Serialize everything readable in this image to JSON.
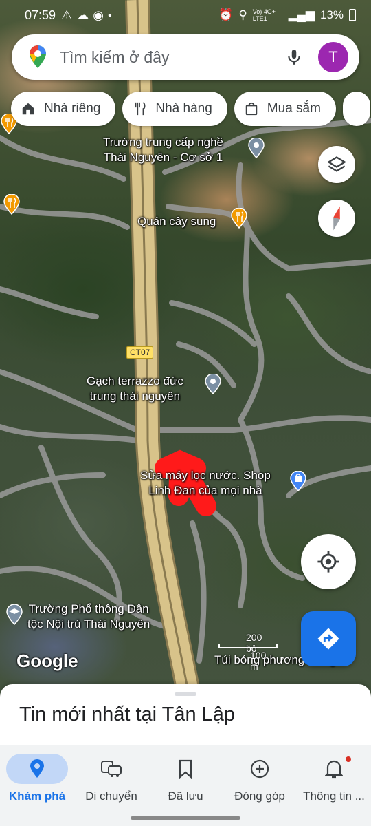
{
  "status_bar": {
    "time": "07:59",
    "network": "Vo) 4G+ LTE1",
    "battery": "13%"
  },
  "search": {
    "placeholder": "Tìm kiếm ở đây",
    "avatar_letter": "T"
  },
  "chips": [
    {
      "label": "Nhà riêng",
      "icon": "home-icon"
    },
    {
      "label": "Nhà hàng",
      "icon": "restaurant-icon"
    },
    {
      "label": "Mua sắm",
      "icon": "shopping-bag-icon"
    }
  ],
  "map": {
    "labels": {
      "school_vocational": "Trường trung cấp nghề\nThái Nguyên - Cơ sở 1",
      "restaurant": "Quán cây sung",
      "highway": "CT07",
      "tile_shop": "Gạch terrazzo đức\ntrung thái nguyên",
      "water_shop": "Sửa máy lọc nước. Shop\nLinh Đan của mọi nhà",
      "boarding_school": "Trường Phổ thông Dân\ntộc Nội trú Thái Nguyên",
      "balloon_shop": "Túi bóng phương Hùng"
    },
    "watermark": "Google",
    "scale_feet": "200 bộ",
    "scale_meters": "100 m"
  },
  "sheet": {
    "title": "Tin mới nhất tại Tân Lập"
  },
  "nav": [
    {
      "label": "Khám phá",
      "icon": "explore-pin-icon",
      "active": true
    },
    {
      "label": "Di chuyển",
      "icon": "commute-icon",
      "active": false
    },
    {
      "label": "Đã lưu",
      "icon": "bookmark-icon",
      "active": false
    },
    {
      "label": "Đóng góp",
      "icon": "add-circle-icon",
      "active": false
    },
    {
      "label": "Thông tin ...",
      "icon": "bell-icon",
      "active": false
    }
  ],
  "colors": {
    "accent": "#1a73e8",
    "avatar": "#9c27b0",
    "annotation_arrow": "#ff1a1a",
    "highway": "#d8c38a"
  }
}
